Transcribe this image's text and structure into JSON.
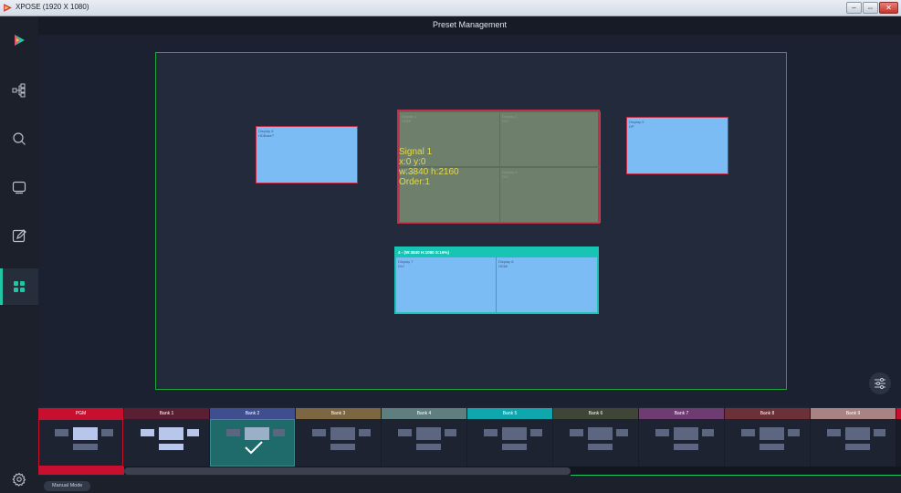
{
  "window": {
    "title": "XPOSE (1920 X 1080)",
    "controls": {
      "minimize": "–",
      "maximize": "⇔",
      "close": "✕"
    }
  },
  "sidebar": {
    "items": [
      {
        "name": "logo",
        "icon": "play-logo-icon"
      },
      {
        "name": "topology",
        "icon": "topology-icon"
      },
      {
        "name": "search",
        "icon": "search-icon"
      },
      {
        "name": "screen",
        "icon": "screen-icon"
      },
      {
        "name": "edit",
        "icon": "edit-icon"
      },
      {
        "name": "preset-management",
        "icon": "grid-icon",
        "active": true
      }
    ],
    "settings_icon": "gear-icon"
  },
  "header": {
    "title": "Preset Management"
  },
  "canvas": {
    "displays": [
      {
        "name": "Display 6",
        "type": "HDBaseT"
      },
      {
        "name": "Display 5",
        "type": "DP"
      }
    ],
    "signal": {
      "cells": [
        {
          "name": "Display 1",
          "type": "HDMI"
        },
        {
          "name": "Display 2",
          "type": "DVI"
        },
        {
          "name": "Display 3",
          "type": ""
        },
        {
          "name": "Display 4",
          "type": "DVI"
        }
      ],
      "info": {
        "line1": "Signal  1",
        "line2": "x:0  y:0",
        "line3": "w:3840  h:2160",
        "line4": "Order:1"
      }
    },
    "group": {
      "header": "4 - (W:3840 H:1080 S:16%)",
      "cells": [
        {
          "name": "Display 7",
          "type": "DVI"
        },
        {
          "name": "Display 8",
          "type": "HDMI"
        }
      ]
    }
  },
  "banks": [
    {
      "label": "PGM",
      "color": "#c8102e"
    },
    {
      "label": "Bank 1",
      "color": "#5a1f33"
    },
    {
      "label": "Bank 2",
      "color": "#3f4e8f"
    },
    {
      "label": "Bank 3",
      "color": "#7d6743"
    },
    {
      "label": "Bank 4",
      "color": "#5f7e80"
    },
    {
      "label": "Bank 5",
      "color": "#0fa6ad"
    },
    {
      "label": "Bank 6",
      "color": "#3f4637"
    },
    {
      "label": "Bank 7",
      "color": "#6f3c72"
    },
    {
      "label": "Bank 8",
      "color": "#6b3038"
    },
    {
      "label": "Bank 9",
      "color": "#a98383"
    }
  ],
  "status": {
    "mode": "Manual Mode"
  }
}
